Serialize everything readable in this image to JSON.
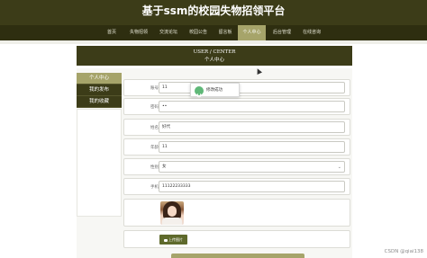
{
  "site": {
    "title": "基于ssm的校园失物招领平台"
  },
  "nav": {
    "items": [
      {
        "label": "首页"
      },
      {
        "label": "失物招领"
      },
      {
        "label": "交流论坛"
      },
      {
        "label": "校园公告"
      },
      {
        "label": "留言板"
      },
      {
        "label": "个人中心",
        "active": true
      },
      {
        "label": "后台管理"
      },
      {
        "label": "在线咨询"
      }
    ]
  },
  "page_header": {
    "en": "USER / CENTER",
    "zh": "个人中心"
  },
  "sidebar": {
    "items": [
      {
        "label": "个人中心",
        "active": true
      },
      {
        "label": "我的发布"
      },
      {
        "label": "我的收藏"
      }
    ]
  },
  "form": {
    "fields": [
      {
        "label": "账号",
        "value": "11"
      },
      {
        "label": "密码",
        "value": "••"
      },
      {
        "label": "姓名",
        "value": "好代"
      },
      {
        "label": "年龄",
        "value": "11"
      },
      {
        "label": "性别",
        "value": "女"
      },
      {
        "label": "手机",
        "value": "11122233333"
      }
    ],
    "upload_label": "上传图片"
  },
  "toast": {
    "text": "修改成功"
  },
  "watermark": "CSDN @qiai138",
  "colors": {
    "primary": "#3c3c18",
    "accent": "#a6a46a",
    "success": "#5fb878"
  }
}
